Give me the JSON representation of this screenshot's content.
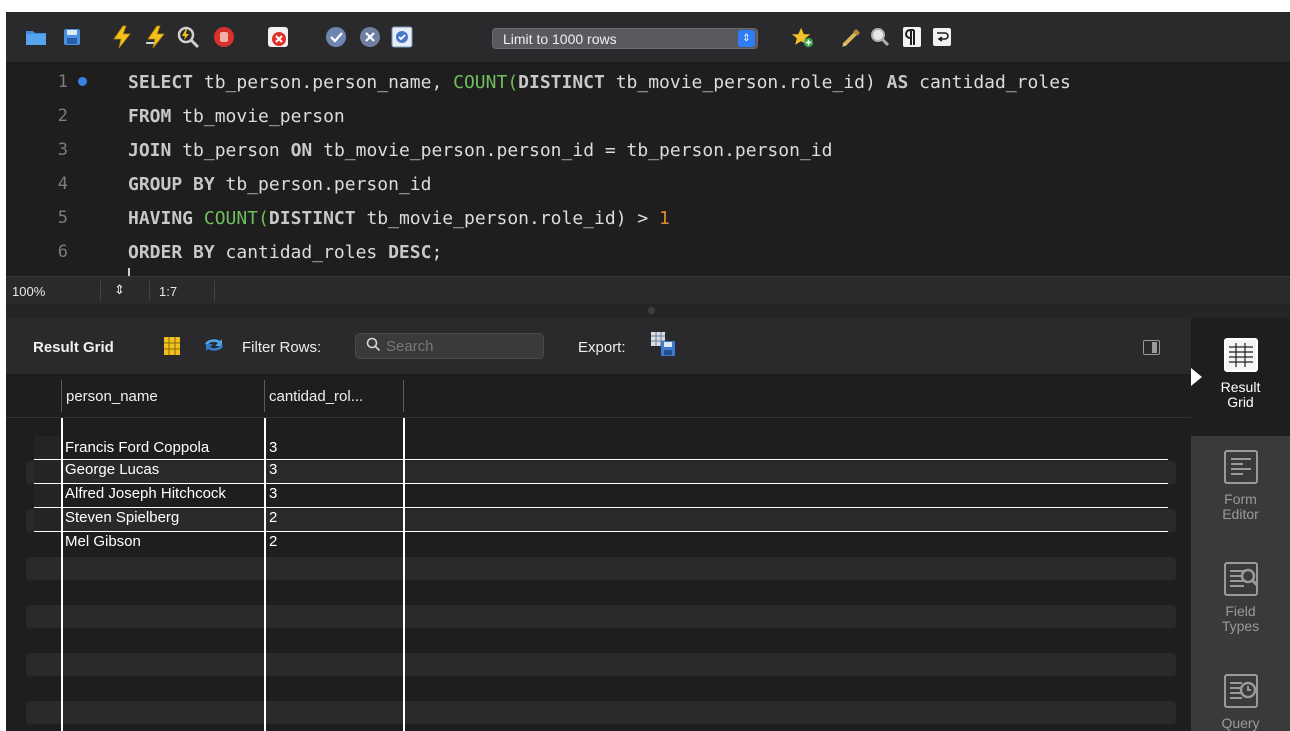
{
  "toolbar": {
    "icons": [
      "folder-icon",
      "save-icon",
      "execute-icon",
      "execute-current-icon",
      "explain-icon",
      "stop-icon",
      "toggle-error-icon",
      "commit-icon",
      "rollback-icon",
      "autocommit-icon",
      "add-snippet-icon",
      "beautify-icon",
      "find-icon",
      "invisible-chars-icon",
      "wrap-icon"
    ],
    "limit_label": "Limit to 1000 rows"
  },
  "editor": {
    "lines": [
      {
        "num": "1",
        "has_marker": true
      },
      {
        "num": "2",
        "has_marker": false
      },
      {
        "num": "3",
        "has_marker": false
      },
      {
        "num": "4",
        "has_marker": false
      },
      {
        "num": "5",
        "has_marker": false
      },
      {
        "num": "6",
        "has_marker": false
      }
    ],
    "tokens": {
      "l1_select": "SELECT",
      "l1_a": " tb_person.person_name, ",
      "l1_count": "COUNT",
      "l1_paren": "(",
      "l1_distinct": "DISTINCT",
      "l1_b": " tb_movie_person.role_id) ",
      "l1_as": "AS",
      "l1_c": " cantidad_roles",
      "l2_from": "FROM",
      "l2_a": " tb_movie_person",
      "l3_join": "JOIN",
      "l3_a": " tb_person ",
      "l3_on": "ON",
      "l3_b": " tb_movie_person.person_id = tb_person.person_id",
      "l4_group": "GROUP BY",
      "l4_a": " tb_person.person_id",
      "l5_having": "HAVING",
      "l5_space": " ",
      "l5_count": "COUNT",
      "l5_paren": "(",
      "l5_distinct": "DISTINCT",
      "l5_a": " tb_movie_person.role_id) > ",
      "l5_num": "1",
      "l6_order": "ORDER BY",
      "l6_a": " cantidad_roles ",
      "l6_desc": "DESC",
      "l6_semi": ";"
    }
  },
  "status": {
    "zoom": "100%",
    "position": "1:7"
  },
  "result_toolbar": {
    "title": "Result Grid",
    "filter_label": "Filter Rows:",
    "search_placeholder": "Search",
    "export_label": "Export:"
  },
  "grid": {
    "columns": [
      "person_name",
      "cantidad_rol..."
    ],
    "rows": [
      [
        "Francis Ford Coppola",
        "3"
      ],
      [
        "George Lucas",
        "3"
      ],
      [
        "Alfred Joseph Hitchcock",
        "3"
      ],
      [
        "Steven Spielberg",
        "2"
      ],
      [
        "Mel Gibson",
        "2"
      ]
    ]
  },
  "side_panel": {
    "items": [
      {
        "label_1": "Result",
        "label_2": "Grid",
        "icon": "result-grid-icon",
        "active": true
      },
      {
        "label_1": "Form",
        "label_2": "Editor",
        "icon": "form-editor-icon",
        "active": false
      },
      {
        "label_1": "Field",
        "label_2": "Types",
        "icon": "field-types-icon",
        "active": false
      },
      {
        "label_1": "Query",
        "label_2": "",
        "icon": "query-stats-icon",
        "active": false
      }
    ]
  },
  "colors": {
    "keyword": "#c8c8c8",
    "function": "#6fbf5a",
    "number": "#e08a2a",
    "accent_blue": "#2f7df6"
  }
}
